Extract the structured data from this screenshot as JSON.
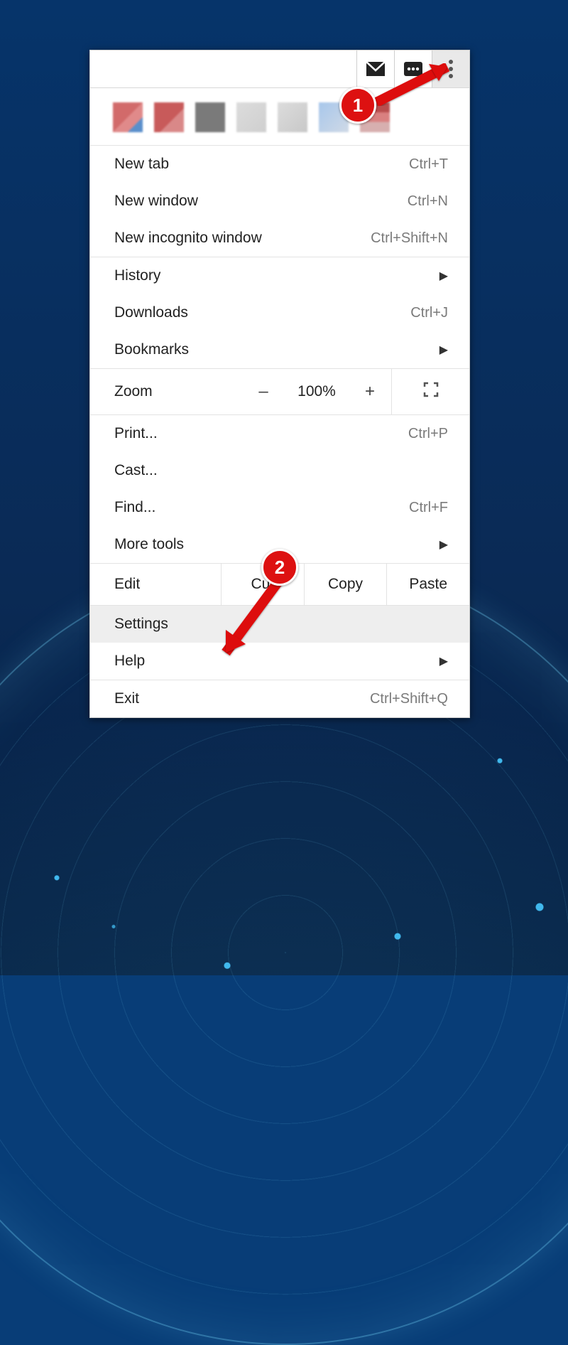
{
  "annotations": {
    "step1": "1",
    "step2": "2"
  },
  "toolbar_icons": {
    "mail": "mail-icon",
    "password": "password-icon",
    "more": "more-vert-icon"
  },
  "menu": {
    "sect1": {
      "new_tab": {
        "label": "New tab",
        "shortcut": "Ctrl+T"
      },
      "new_win": {
        "label": "New window",
        "shortcut": "Ctrl+N"
      },
      "incog": {
        "label": "New incognito window",
        "shortcut": "Ctrl+Shift+N"
      }
    },
    "sect2": {
      "history": {
        "label": "History"
      },
      "downloads": {
        "label": "Downloads",
        "shortcut": "Ctrl+J"
      },
      "bookmarks": {
        "label": "Bookmarks"
      }
    },
    "zoom": {
      "label": "Zoom",
      "minus": "–",
      "value": "100%",
      "plus": "+"
    },
    "sect3": {
      "print": {
        "label": "Print...",
        "shortcut": "Ctrl+P"
      },
      "cast": {
        "label": "Cast..."
      },
      "find": {
        "label": "Find...",
        "shortcut": "Ctrl+F"
      },
      "more": {
        "label": "More tools"
      }
    },
    "edit": {
      "label": "Edit",
      "cut": "Cut",
      "copy": "Copy",
      "paste": "Paste"
    },
    "sect4": {
      "settings": {
        "label": "Settings"
      },
      "help": {
        "label": "Help"
      }
    },
    "sect5": {
      "exit": {
        "label": "Exit",
        "shortcut": "Ctrl+Shift+Q"
      }
    }
  }
}
